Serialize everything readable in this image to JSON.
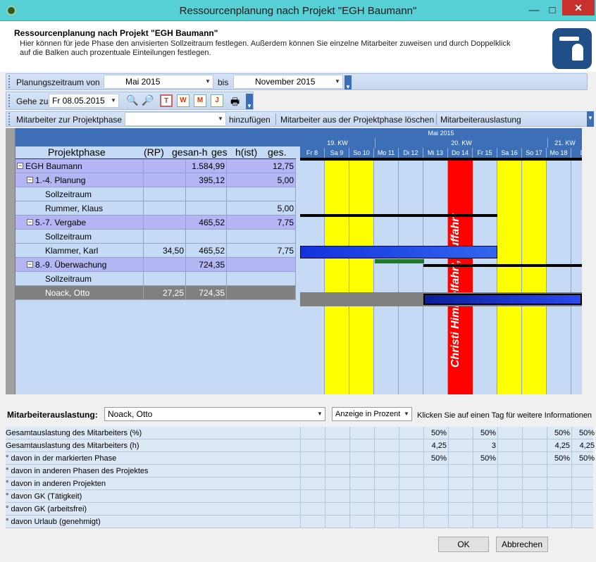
{
  "window": {
    "title": "Ressourcenplanung nach Projekt \"EGH Baumann\""
  },
  "header": {
    "title": "Ressourcenplanung nach Projekt \"EGH Baumann\"",
    "desc1": "Hier können für jede Phase den anvisierten Sollzeitraum festlegen. Außerdem können Sie einzelne Mitarbeiter zuweisen und durch Doppelklick",
    "desc2": "auf die Balken auch prozentuale Einteilungen festlegen."
  },
  "toolbar1": {
    "label_from": "Planungszeitraum von",
    "from": "Mai 2015",
    "label_to": "bis",
    "to": "November 2015"
  },
  "toolbar2": {
    "label": "Gehe zu",
    "date": "Fr 08.05.2015",
    "t": "T",
    "w": "W",
    "m": "M",
    "j": "J"
  },
  "toolbar3": {
    "label": "Mitarbeiter zur Projektphase",
    "add": "hinzufügen",
    "delete": "Mitarbeiter aus der Projektphase löschen",
    "util": "Mitarbeiterauslastung"
  },
  "table": {
    "headers": [
      "Projektphase",
      "(RP)",
      "gesan-h",
      "ges",
      "h(ist)",
      "ges."
    ],
    "rows": [
      {
        "name": "EGH Baumann",
        "rp": "",
        "ges": "1.584,99",
        "ist": "12,75",
        "indent": 0,
        "kind": "phase"
      },
      {
        "name": "1.-4. Planung",
        "rp": "",
        "ges": "395,12",
        "ist": "5,00",
        "indent": 1,
        "kind": "phase"
      },
      {
        "name": "Sollzeitraum",
        "rp": "",
        "ges": "",
        "ist": "",
        "indent": 2,
        "kind": "sub"
      },
      {
        "name": "Rummer, Klaus",
        "rp": "",
        "ges": "",
        "ist": "5,00",
        "indent": 2,
        "kind": "sub"
      },
      {
        "name": "5.-7. Vergabe",
        "rp": "",
        "ges": "465,52",
        "ist": "7,75",
        "indent": 1,
        "kind": "phase"
      },
      {
        "name": "Sollzeitraum",
        "rp": "",
        "ges": "",
        "ist": "",
        "indent": 2,
        "kind": "sub"
      },
      {
        "name": "Klammer, Karl",
        "rp": "34,50",
        "ges": "465,52",
        "ist": "7,75",
        "indent": 2,
        "kind": "sub"
      },
      {
        "name": "8.-9. Überwachung",
        "rp": "",
        "ges": "724,35",
        "ist": "",
        "indent": 1,
        "kind": "phase"
      },
      {
        "name": "Sollzeitraum",
        "rp": "",
        "ges": "",
        "ist": "",
        "indent": 2,
        "kind": "sub"
      },
      {
        "name": "Noack, Otto",
        "rp": "27,25",
        "ges": "724,35",
        "ist": "",
        "indent": 2,
        "kind": "selected"
      }
    ]
  },
  "calendar": {
    "month": "Mai 2015",
    "weeks": [
      "19. KW",
      "20. KW",
      "21. KW"
    ],
    "days": [
      "Fr 8",
      "Sa 9",
      "So 10",
      "Mo 11",
      "Di 12",
      "Mi 13",
      "Do 14",
      "Fr 15",
      "Sa 16",
      "So 17",
      "Mo 18",
      "Di"
    ],
    "holiday": "Christi Himmelfahrt, Auffahrt",
    "colors": {
      "weekend": "#ffff00",
      "holiday": "#ff0000",
      "bar": "#2255ee"
    }
  },
  "util": {
    "label": "Mitarbeiterauslastung:",
    "employee": "Noack, Otto",
    "mode": "Anzeige in Prozent",
    "hint": "Klicken Sie auf einen Tag für weitere Informationen",
    "rows": [
      {
        "label": "Gesamtauslastung des Mitarbeiters (%)",
        "vals": [
          "",
          "",
          "",
          "",
          "",
          "50%",
          "",
          "50%",
          "",
          "",
          "50%",
          "50%"
        ]
      },
      {
        "label": "Gesamtauslastung des Mitarbeiters (h)",
        "vals": [
          "",
          "",
          "",
          "",
          "",
          "4,25",
          "",
          "3",
          "",
          "",
          "4,25",
          "4,25"
        ]
      },
      {
        "label": "° davon in der markierten Phase",
        "vals": [
          "",
          "",
          "",
          "",
          "",
          "50%",
          "",
          "50%",
          "",
          "",
          "50%",
          "50%"
        ]
      },
      {
        "label": "° davon in anderen Phasen des Projektes",
        "vals": []
      },
      {
        "label": "° davon in anderen Projekten",
        "vals": []
      },
      {
        "label": "° davon GK (Tätigkeit)",
        "vals": []
      },
      {
        "label": "° davon GK (arbeitsfrei)",
        "vals": []
      },
      {
        "label": "° davon Urlaub (genehmigt)",
        "vals": []
      }
    ]
  },
  "buttons": {
    "ok": "OK",
    "cancel": "Abbrechen"
  }
}
